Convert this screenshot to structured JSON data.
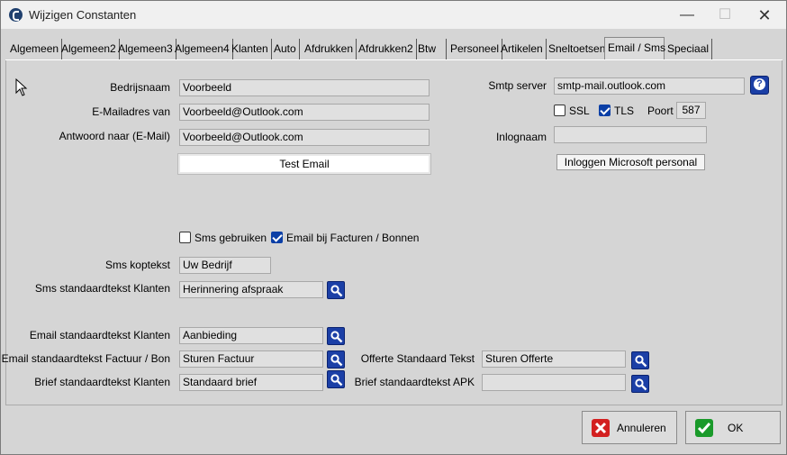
{
  "window": {
    "title": "Wijzigen Constanten",
    "minimize": "—",
    "maximize": "☐",
    "close": "✕"
  },
  "tabs": [
    {
      "label": "Algemeen"
    },
    {
      "label": "Algemeen2"
    },
    {
      "label": "Algemeen3"
    },
    {
      "label": "Algemeen4"
    },
    {
      "label": "Klanten"
    },
    {
      "label": "Auto"
    },
    {
      "label": "Afdrukken"
    },
    {
      "label": "Afdrukken2"
    },
    {
      "label": "Btw"
    },
    {
      "label": "Personeel"
    },
    {
      "label": "Artikelen"
    },
    {
      "label": "Sneltoetsen"
    },
    {
      "label": "Email / Sms"
    },
    {
      "label": "Speciaal"
    }
  ],
  "active_tab": "Email / Sms",
  "email": {
    "bedrijfsnaam_label": "Bedrijsnaam",
    "bedrijfsnaam_value": "Voorbeeld",
    "mailadres_label": "E-Mailadres van",
    "mailadres_value": "Voorbeeld@Outlook.com",
    "antwoord_label": "Antwoord naar (E-Mail)",
    "antwoord_value": "Voorbeeld@Outlook.com",
    "test_button": "Test Email"
  },
  "smtp": {
    "server_label": "Smtp server",
    "server_value": "smtp-mail.outlook.com",
    "ssl_label": "SSL",
    "ssl_checked": false,
    "tls_label": "TLS",
    "tls_checked": true,
    "poort_label": "Poort",
    "poort_value": "587",
    "inlognaam_label": "Inlognaam",
    "inlognaam_value": "",
    "login_button": "Inloggen Microsoft personal"
  },
  "sms": {
    "gebruiken_label": "Sms gebruiken",
    "gebruiken_checked": false,
    "email_facturen_label": "Email bij Facturen / Bonnen",
    "email_facturen_checked": true,
    "koptekst_label": "Sms koptekst",
    "koptekst_value": "Uw Bedrijf",
    "standaard_label": "Sms standaardtekst Klanten",
    "standaard_value": "Herinnering afspraak"
  },
  "templates": {
    "email_klanten_label": "Email standaardtekst Klanten",
    "email_klanten_value": "Aanbieding",
    "email_factuur_label": "Email standaardtekst Factuur / Bon",
    "email_factuur_value": "Sturen Factuur",
    "brief_klanten_label": "Brief standaardtekst Klanten",
    "brief_klanten_value": "Standaard brief",
    "offerte_label": "Offerte Standaard Tekst",
    "offerte_value": "Sturen Offerte",
    "brief_apk_label": "Brief standaardtekst APK",
    "brief_apk_value": ""
  },
  "footer": {
    "cancel": "Annuleren",
    "ok": "OK"
  },
  "colors": {
    "accent": "#1b3fa6",
    "cancel_icon": "#d32020",
    "ok_icon": "#1a9a2a"
  }
}
